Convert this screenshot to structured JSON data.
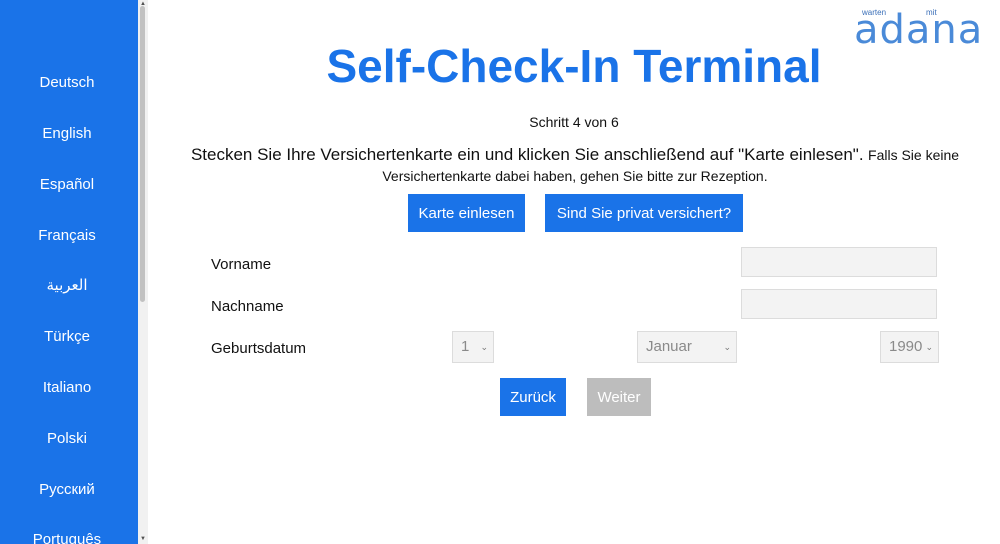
{
  "sidebar": {
    "languages": [
      "Deutsch",
      "English",
      "Español",
      "Français",
      "العربية",
      "Türkçe",
      "Italiano",
      "Polski",
      "Русский",
      "Português"
    ]
  },
  "logo": {
    "small_left": "warten",
    "small_right": "mit",
    "brand": "adana"
  },
  "header": {
    "title": "Self-Check-In Terminal",
    "step": "Schritt 4 von 6"
  },
  "instruction": {
    "main": "Stecken Sie Ihre Versichertenkarte ein und klicken Sie anschließend auf \"Karte einlesen\".",
    "secondary": "Falls Sie keine Versichertenkarte dabei haben, gehen Sie bitte zur Rezeption."
  },
  "actions": {
    "read_card": "Karte einlesen",
    "private_insured": "Sind Sie privat versichert?",
    "back": "Zurück",
    "next": "Weiter"
  },
  "form": {
    "first_name_label": "Vorname",
    "first_name_value": "",
    "last_name_label": "Nachname",
    "last_name_value": "",
    "birthdate_label": "Geburtsdatum",
    "day": "1",
    "month": "Januar",
    "year": "1990"
  },
  "colors": {
    "accent": "#1a73e8",
    "disabled": "#bdbdbd"
  }
}
